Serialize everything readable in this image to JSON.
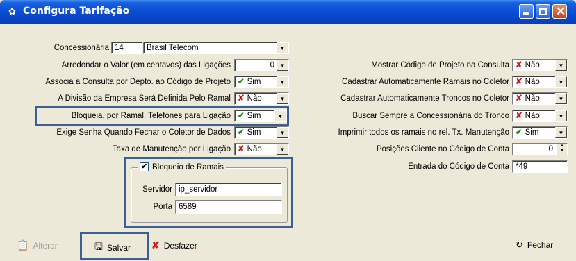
{
  "window": {
    "title": "Configura Tarifação"
  },
  "left": {
    "concessionaria": {
      "label": "Concessionária",
      "code": "14",
      "name": "Brasil Telecom"
    },
    "arredondar": {
      "label": "Arredondar o Valor (em centavos) das Ligações",
      "value": "0"
    },
    "associa": {
      "label": "Associa a Consulta por Depto. ao Código de Projeto",
      "value": "Sim"
    },
    "divisao": {
      "label": "A Divisão da Empresa Será Definida Pelo Ramal",
      "value": "Não"
    },
    "bloqueia": {
      "label": "Bloqueia, por Ramal, Telefones para Ligação",
      "value": "Sim"
    },
    "exige": {
      "label": "Exige Senha Quando Fechar o Coletor de Dados",
      "value": "Sim"
    },
    "taxa": {
      "label": "Taxa de Manutenção por Ligação",
      "value": "Não"
    }
  },
  "right": {
    "mostrar": {
      "label": "Mostrar Código de Projeto na Consulta",
      "value": "Não"
    },
    "cad_ramais": {
      "label": "Cadastrar Automaticamente Ramais no Coletor",
      "value": "Não"
    },
    "cad_troncos": {
      "label": "Cadastrar Automaticamente Troncos no Coletor",
      "value": "Não"
    },
    "buscar": {
      "label": "Buscar Sempre a Concessionária do Tronco",
      "value": "Não"
    },
    "imprimir": {
      "label": "Imprimir todos os ramais no rel. Tx. Manutenção",
      "value": "Sim"
    },
    "posicoes": {
      "label": "Posições Cliente no Código de Conta",
      "value": "0"
    },
    "entrada": {
      "label": "Entrada do Código de Conta",
      "value": "*49"
    }
  },
  "bloqueio": {
    "legend": "Bloqueio de Ramais",
    "checked": true,
    "servidor_label": "Servidor",
    "servidor_value": "ip_servidor",
    "porta_label": "Porta",
    "porta_value": "6589"
  },
  "buttons": {
    "alterar": "Alterar",
    "salvar": "Salvar",
    "desfazer": "Desfazer",
    "fechar": "Fechar"
  },
  "colors": {
    "highlight": "#3a5f95",
    "titlebar": "#0a4ed4",
    "check": "#1d8a1d",
    "x": "#d11a1a"
  },
  "icons": {
    "check": "check-icon",
    "x": "x-icon",
    "save": "save-icon",
    "undo": "undo-icon",
    "close": "close-icon",
    "edit": "edit-icon"
  }
}
